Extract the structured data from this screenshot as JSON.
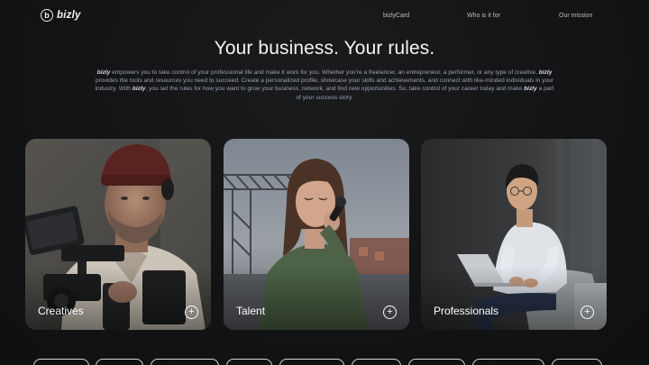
{
  "brand": {
    "name": "bizly",
    "icon": "b-circle-logo-icon"
  },
  "nav": {
    "items": [
      {
        "label": "bizlyCard"
      },
      {
        "label": "Who is it for"
      },
      {
        "label": "Our mission"
      }
    ]
  },
  "hero": {
    "title": "Your business. Your rules.",
    "intro": {
      "p1": " empowers you to take control of your professional life and make it work for you. Whether you're a freelancer, an entrepreneur, a performer, or any type of creative, ",
      "p2": " provides the tools and resources you need to succeed. Create a personalized profile, showcase your skills and achievements, and connect with like-minded individuals in your industry. With ",
      "p3": ", you set the rules for how you want to grow your business, network, and find new opportunities. So, take control of your career today and make ",
      "p4": " a part of your success story."
    }
  },
  "cards": [
    {
      "label": "Creatives",
      "action_icon": "plus-icon"
    },
    {
      "label": "Talent",
      "action_icon": "plus-icon"
    },
    {
      "label": "Professionals",
      "action_icon": "plus-icon"
    }
  ],
  "colors": {
    "background": "#111213",
    "title": "#f4f4f5",
    "intro_text": "#9aa0b3",
    "nav_text": "#bdbec1"
  }
}
